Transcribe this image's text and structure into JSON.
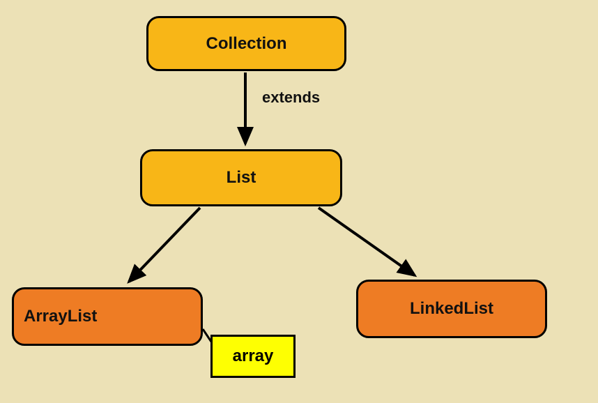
{
  "diagram": {
    "nodes": {
      "collection": {
        "label": "Collection"
      },
      "list": {
        "label": "List"
      },
      "arraylist": {
        "label": "ArrayList"
      },
      "linkedlist": {
        "label": "LinkedList"
      },
      "array_store": {
        "label": "array"
      }
    },
    "edges": {
      "collection_to_list": {
        "label": "extends"
      }
    }
  }
}
